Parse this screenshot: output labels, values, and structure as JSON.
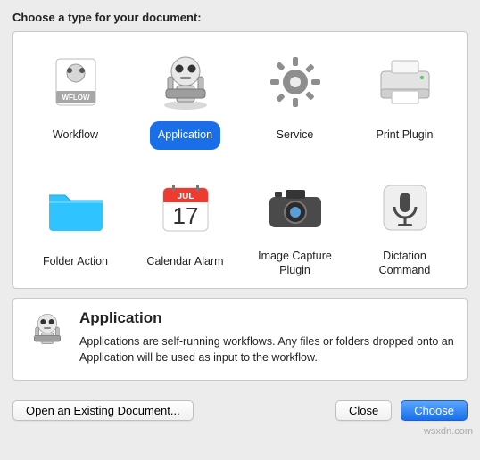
{
  "header": {
    "prompt": "Choose a type for your document:"
  },
  "types": [
    {
      "id": "workflow",
      "label": "Workflow",
      "icon": "workflow",
      "selected": false
    },
    {
      "id": "application",
      "label": "Application",
      "icon": "robot",
      "selected": true
    },
    {
      "id": "service",
      "label": "Service",
      "icon": "gear",
      "selected": false
    },
    {
      "id": "print-plugin",
      "label": "Print Plugin",
      "icon": "printer",
      "selected": false
    },
    {
      "id": "folder-action",
      "label": "Folder Action",
      "icon": "folder",
      "selected": false
    },
    {
      "id": "calendar-alarm",
      "label": "Calendar Alarm",
      "icon": "calendar",
      "calendar": {
        "month": "JUL",
        "day": "17"
      },
      "selected": false
    },
    {
      "id": "image-capture-plugin",
      "label": "Image Capture Plugin",
      "icon": "camera",
      "selected": false
    },
    {
      "id": "dictation-command",
      "label": "Dictation Command",
      "icon": "mic",
      "selected": false
    }
  ],
  "description": {
    "title": "Application",
    "body": "Applications are self-running workflows. Any files or folders dropped onto an Application will be used as input to the workflow."
  },
  "footer": {
    "open_existing": "Open an Existing Document...",
    "close": "Close",
    "choose": "Choose"
  },
  "watermark": "wsxdn.com",
  "colors": {
    "accent": "#1a6fe8",
    "folder": "#2fc3ff",
    "calendar_red": "#ef3b2f"
  }
}
